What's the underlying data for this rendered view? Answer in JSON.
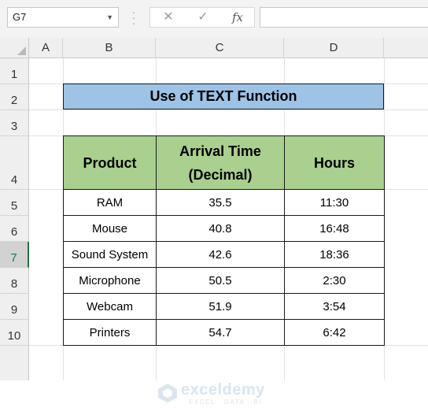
{
  "formula_bar": {
    "name_box": "G7",
    "cancel_icon": "cancel-icon",
    "enter_icon": "check-icon",
    "fx_label": "fx",
    "formula": ""
  },
  "columns": [
    "A",
    "B",
    "C",
    "D"
  ],
  "rows": [
    "1",
    "2",
    "3",
    "4",
    "5",
    "6",
    "7",
    "8",
    "9",
    "10"
  ],
  "selected_row": "7",
  "sheet": {
    "title": "Use of TEXT Function",
    "header": {
      "product": "Product",
      "arrival_line1": "Arrival Time",
      "arrival_line2": "(Decimal)",
      "hours": "Hours"
    },
    "records": [
      {
        "product": "RAM",
        "arrival": "35.5",
        "hours": "11:30"
      },
      {
        "product": "Mouse",
        "arrival": "40.8",
        "hours": "16:48"
      },
      {
        "product": "Sound System",
        "arrival": "42.6",
        "hours": "18:36"
      },
      {
        "product": "Microphone",
        "arrival": "50.5",
        "hours": "2:30"
      },
      {
        "product": "Webcam",
        "arrival": "51.9",
        "hours": "3:54"
      },
      {
        "product": "Printers",
        "arrival": "54.7",
        "hours": "6:42"
      }
    ]
  },
  "colors": {
    "title_fill": "#9dc3e6",
    "header_fill": "#a9d08e",
    "selection": "#217346"
  },
  "watermark": {
    "name": "exceldemy",
    "tagline": "EXCEL · DATA · BI"
  }
}
